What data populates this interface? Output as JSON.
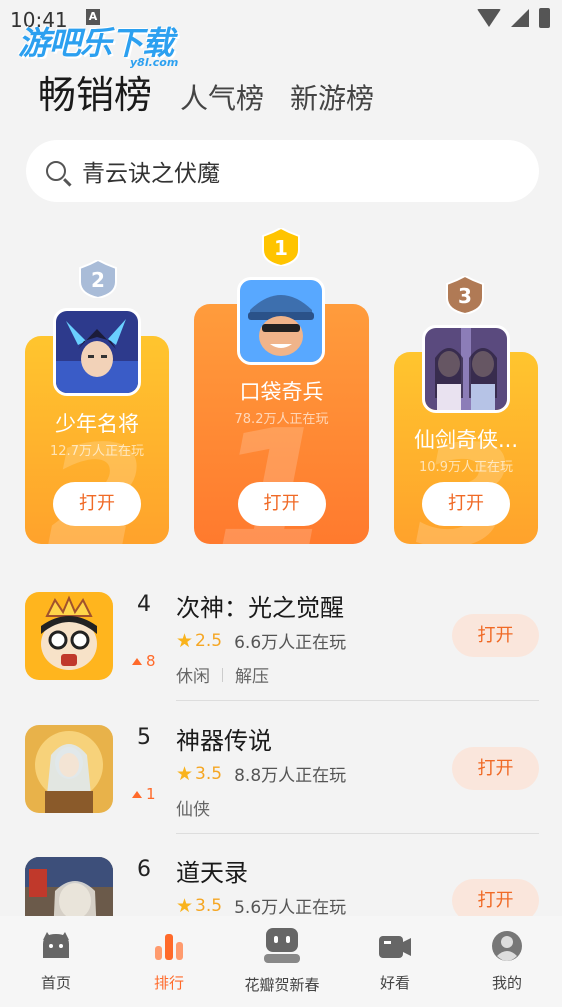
{
  "status_bar": {
    "time": "10:41",
    "notice": "A"
  },
  "watermark": {
    "main": "游吧乐下载",
    "sub": "y8l.com"
  },
  "tabs": [
    {
      "label": "畅销榜",
      "active": true
    },
    {
      "label": "人气榜",
      "active": false
    },
    {
      "label": "新游榜",
      "active": false
    }
  ],
  "search": {
    "placeholder": "青云诀之伏魔"
  },
  "podium": {
    "first": {
      "rank": "1",
      "name": "口袋奇兵",
      "players": "78.2万人正在玩",
      "button": "打开"
    },
    "second": {
      "rank": "2",
      "name": "少年名将",
      "players": "12.7万人正在玩",
      "button": "打开"
    },
    "third": {
      "rank": "3",
      "name": "仙剑奇侠...",
      "players": "10.9万人正在玩",
      "button": "打开"
    }
  },
  "list": [
    {
      "rank": "4",
      "title": "次神：光之觉醒",
      "rating": "2.5",
      "players": "6.6万人正在玩",
      "trend": "8",
      "tags": [
        "休闲",
        "解压"
      ],
      "button": "打开"
    },
    {
      "rank": "5",
      "title": "神器传说",
      "rating": "3.5",
      "players": "8.8万人正在玩",
      "trend": "1",
      "tags": [
        "仙侠"
      ],
      "button": "打开"
    },
    {
      "rank": "6",
      "title": "道天录",
      "rating": "3.5",
      "players": "5.6万人正在玩",
      "trend": "",
      "tags": [],
      "button": "打开"
    }
  ],
  "bottom_nav": [
    {
      "label": "首页",
      "icon": "home-icon",
      "active": false
    },
    {
      "label": "排行",
      "icon": "ranking-icon",
      "active": true
    },
    {
      "label": "花瓣贺新春",
      "icon": "robot-icon",
      "active": false
    },
    {
      "label": "好看",
      "icon": "video-icon",
      "active": false
    },
    {
      "label": "我的",
      "icon": "profile-icon",
      "active": false
    }
  ],
  "colors": {
    "accent": "#ff6a2a",
    "gold": "#ffc52e",
    "orange": "#ff7a2e",
    "button_bg": "#fae6dc"
  }
}
